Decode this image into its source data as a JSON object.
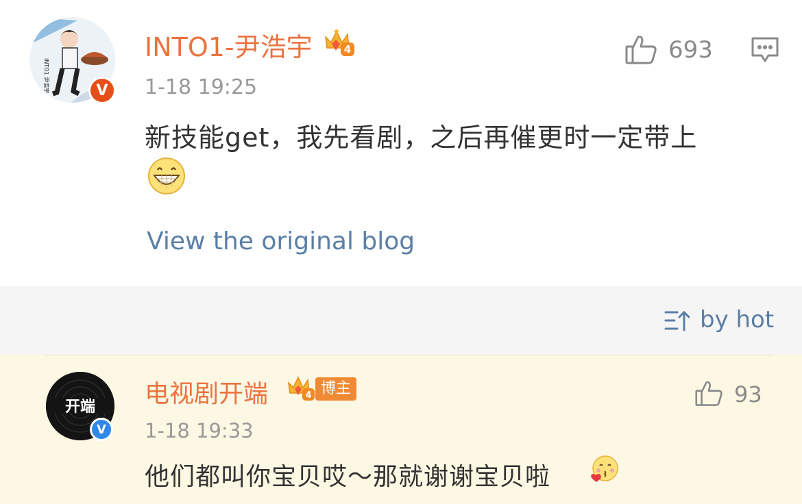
{
  "post": {
    "username": "INTO1-尹浩宇",
    "level_badge": "4",
    "time": "1-18 19:25",
    "like_count": "693",
    "content": "新技能get，我先看剧，之后再催更时一定带上",
    "view_original_label": "View the original blog",
    "verified_badge": "V",
    "avatar_text": "INTO1 尹浩宇",
    "icons": [
      "thumbs-up-icon",
      "comment-icon",
      "grin-emoji-icon",
      "crown-diamond-icon"
    ]
  },
  "sort": {
    "label": "by hot",
    "icon": "sort-icon"
  },
  "comment": {
    "username": "电视剧开端",
    "level_badge": "4",
    "role_badge": "博主",
    "time": "1-18 19:33",
    "like_count": "93",
    "content": "他们都叫你宝贝哎～那就谢谢宝贝啦",
    "verified_badge": "V",
    "avatar_text": "开端",
    "icons": [
      "thumbs-up-icon",
      "kiss-heart-emoji-icon",
      "crown-diamond-icon"
    ]
  },
  "colors": {
    "username": "#eb7340",
    "link": "#5a7fa6",
    "text": "#333333",
    "meta": "#999999",
    "sort_bg": "#f5f5f5",
    "comment_bg": "#fdf8e4",
    "badge_orange": "#f18a35",
    "verified_blue": "#2f87e8"
  }
}
